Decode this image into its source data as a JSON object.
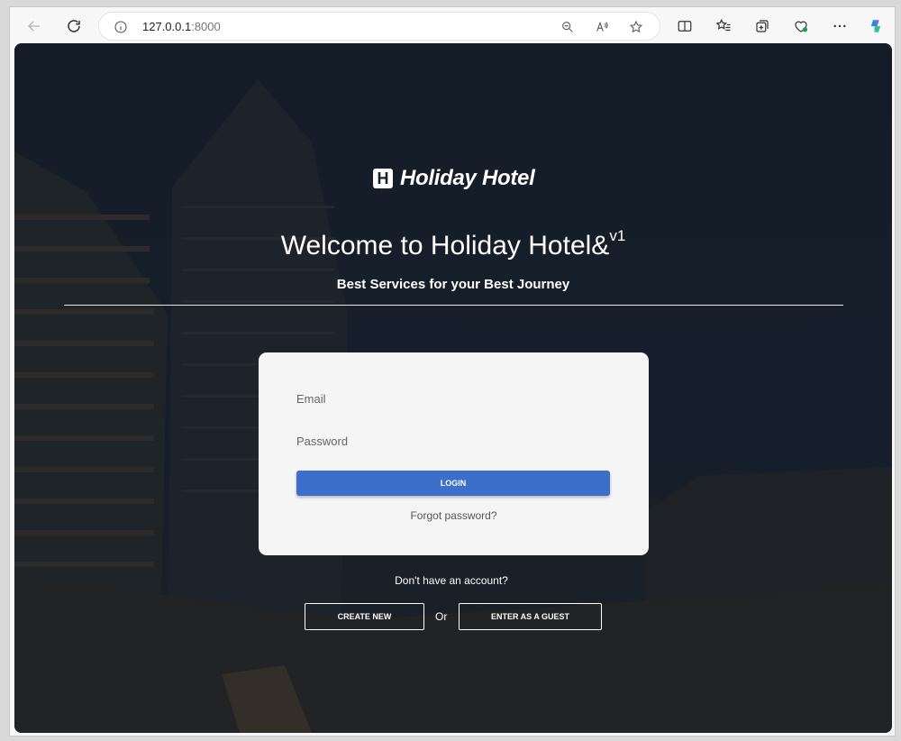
{
  "browser": {
    "url_host": "127.0.0.1",
    "url_port": ":8000"
  },
  "brand": {
    "mark": "H",
    "name": "Holiday Hotel"
  },
  "hero": {
    "welcome": "Welcome to Holiday Hotel&",
    "version": "v1",
    "tagline": "Best Services for your Best Journey"
  },
  "login_form": {
    "email_placeholder": "Email",
    "password_placeholder": "Password",
    "login_label": "LOGIN",
    "forgot_label": "Forgot password?"
  },
  "signup": {
    "prompt": "Don't have an account?",
    "create_label": "CREATE NEW",
    "or_label": "Or",
    "guest_label": "ENTER AS A GUEST"
  },
  "colors": {
    "primary_button": "#3b6fc9",
    "card_background": "#f5f5f5",
    "page_overlay": "#0a101a"
  }
}
